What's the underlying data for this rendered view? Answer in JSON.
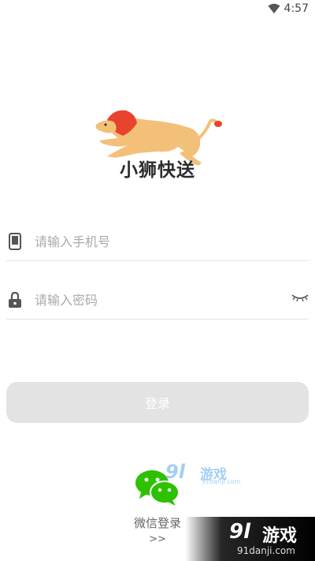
{
  "status_bar": {
    "time": "4:57"
  },
  "brand": {
    "name": "小狮快送",
    "accent_color": "#e8432d",
    "body_color": "#f3c07a"
  },
  "login_form": {
    "phone_placeholder": "请输入手机号",
    "password_placeholder": "请输入密码",
    "submit_label": "登录"
  },
  "wechat_login": {
    "label": "微信登录",
    "arrow": ">>"
  },
  "watermark": {
    "small": {
      "number": "9l",
      "text": "游戏",
      "site": "91danji.com"
    },
    "corner": {
      "number": "9l",
      "text": "游戏",
      "site": "91danji.com"
    }
  },
  "icons": [
    "wifi-icon",
    "phone-icon",
    "lock-icon",
    "eye-closed-icon",
    "wechat-icon",
    "lion-logo"
  ]
}
